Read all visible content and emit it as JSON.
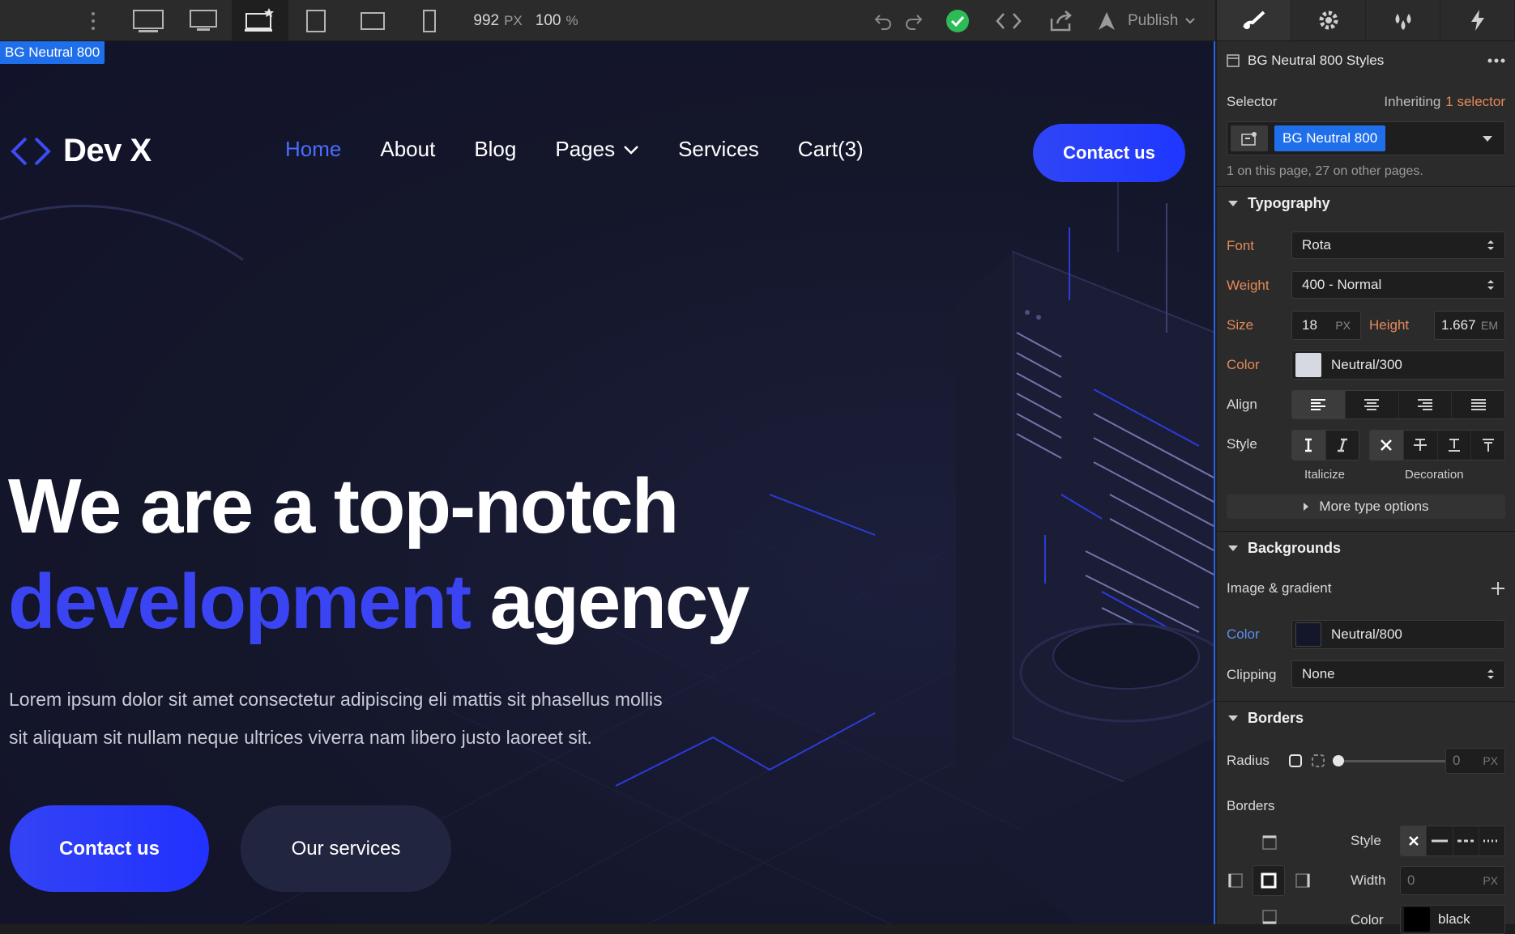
{
  "toolbar": {
    "width_value": "992",
    "width_unit": "PX",
    "zoom_value": "100",
    "zoom_unit": "%",
    "publish_label": "Publish"
  },
  "canvas": {
    "selected_badge": "BG Neutral 800",
    "site": {
      "logo_name": "Dev X",
      "nav": [
        {
          "label": "Home",
          "active": true
        },
        {
          "label": "About"
        },
        {
          "label": "Blog"
        },
        {
          "label": "Pages",
          "dropdown": true
        },
        {
          "label": "Services"
        },
        {
          "label": "Cart(3)"
        }
      ],
      "contact_top": "Contact us",
      "hero_line1": "We are a top-notch",
      "hero_accent": "development",
      "hero_rest": "agency",
      "hero_para_1": "Lorem ipsum dolor sit amet consectetur adipiscing eli mattis sit phasellus mollis",
      "hero_para_2": "sit aliquam sit nullam neque ultrices viverra nam libero justo laoreet sit.",
      "btn_primary": "Contact us",
      "btn_secondary": "Our services"
    }
  },
  "panel": {
    "header_title": "BG Neutral 800 Styles",
    "selector_label": "Selector",
    "inheriting_text": "Inheriting",
    "inheriting_count": "1 selector",
    "selector_chip": "BG Neutral 800",
    "usage_note": "1 on this page, 27 on other pages.",
    "typography": {
      "title": "Typography",
      "font_label": "Font",
      "font_value": "Rota",
      "weight_label": "Weight",
      "weight_value": "400 - Normal",
      "size_label": "Size",
      "size_value": "18",
      "size_unit": "PX",
      "height_label": "Height",
      "height_value": "1.667",
      "height_unit": "EM",
      "color_label": "Color",
      "color_value": "Neutral/300",
      "align_label": "Align",
      "style_label": "Style",
      "italicize_caption": "Italicize",
      "decoration_caption": "Decoration",
      "more_options": "More type options"
    },
    "backgrounds": {
      "title": "Backgrounds",
      "image_gradient_label": "Image & gradient",
      "color_label": "Color",
      "color_value": "Neutral/800",
      "clipping_label": "Clipping",
      "clipping_value": "None"
    },
    "borders": {
      "title": "Borders",
      "radius_label": "Radius",
      "radius_value": "0",
      "radius_unit": "PX",
      "borders_label": "Borders",
      "style_label": "Style",
      "width_label": "Width",
      "width_value": "0",
      "width_unit": "PX",
      "color_label": "Color",
      "color_value": "black"
    }
  },
  "colors": {
    "accent_blue": "#2f45f5",
    "neutral_800": "#14162a",
    "neutral_300": "#d7d9e2",
    "set_label_orange": "#e48a5a"
  }
}
